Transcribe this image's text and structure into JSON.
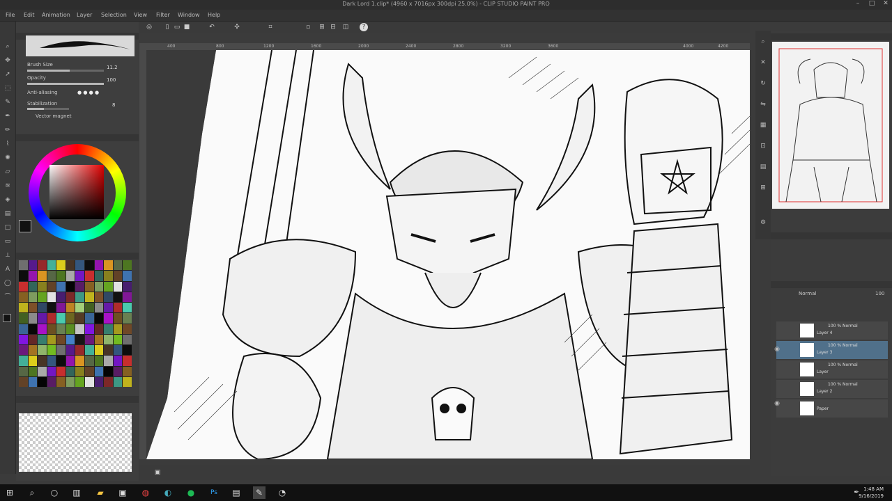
{
  "window": {
    "title": "Dark Lord 1.clip* (4960 x 7016px 300dpi 25.0%) - CLIP STUDIO PAINT PRO",
    "controls": [
      "–",
      "□",
      "✕"
    ]
  },
  "menu": [
    "File",
    "Edit",
    "Animation",
    "Layer",
    "Selection",
    "View",
    "Filter",
    "Window",
    "Help"
  ],
  "tool_property": {
    "brush_size_label": "Brush Size",
    "brush_size_value": "11.2",
    "brush_size_fill": 0.55,
    "opacity_label": "Opacity",
    "opacity_value": "100",
    "opacity_fill": 1.0,
    "anti_alias_label": "Anti-aliasing",
    "stabilization_label": "Stabilization",
    "stabilization_value": "8",
    "vector_magnet_label": "Vector magnet"
  },
  "ruler_ticks": [
    "400",
    "800",
    "1200",
    "1600",
    "2000",
    "2400",
    "2800",
    "3200",
    "3600",
    "4000",
    "4200"
  ],
  "layer_panel": {
    "blend_mode": "Normal",
    "opacity": "100",
    "layers": [
      {
        "name": "Layer 4",
        "blend": "100 % Normal",
        "selected": false
      },
      {
        "name": "Layer 3",
        "blend": "100 % Normal",
        "selected": true
      },
      {
        "name": "Layer",
        "blend": "100 % Normal",
        "selected": false
      },
      {
        "name": "Layer 2",
        "blend": "100 % Normal",
        "selected": false
      },
      {
        "name": "Paper",
        "blend": "",
        "selected": false
      }
    ]
  },
  "taskbar": {
    "time": "1:48 AM",
    "date": "9/16/2019"
  },
  "colors": {
    "accent": "#e00000",
    "selected_layer": "#50708a"
  }
}
